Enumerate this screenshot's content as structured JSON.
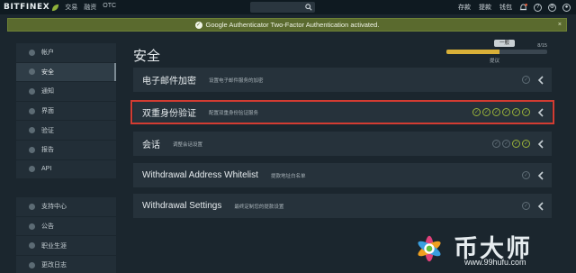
{
  "topbar": {
    "logo": "BITFINEX",
    "nav": [
      "交易",
      "融资",
      "OTC"
    ],
    "right_links": [
      "存款",
      "提款",
      "钱包"
    ],
    "icons": [
      "bell-icon",
      "help-icon",
      "settings-icon",
      "user-icon"
    ]
  },
  "notice": {
    "text": "Google Authenticator Two-Factor Authentication activated.",
    "close": "×"
  },
  "sidebar": {
    "group1": [
      {
        "label": "帐户",
        "icon": "account-icon"
      },
      {
        "label": "安全",
        "icon": "lock-icon",
        "active": true
      },
      {
        "label": "通知",
        "icon": "notification-icon"
      },
      {
        "label": "界面",
        "icon": "interface-icon"
      },
      {
        "label": "验证",
        "icon": "verify-icon"
      },
      {
        "label": "报告",
        "icon": "report-icon"
      },
      {
        "label": "API",
        "icon": "api-icon"
      }
    ],
    "group2": [
      {
        "label": "支持中心",
        "icon": "support-icon"
      },
      {
        "label": "公告",
        "icon": "announcement-icon"
      },
      {
        "label": "职业生涯",
        "icon": "career-icon"
      },
      {
        "label": "更改日志",
        "icon": "changelog-icon"
      }
    ]
  },
  "main": {
    "title": "安全",
    "security_level": {
      "badge": "一般",
      "fraction": "8/15",
      "progress": 0.53,
      "caption": "提议"
    },
    "rows": [
      {
        "title": "电子邮件加密",
        "desc": "设置电子邮件服务的加密",
        "checks": [
          "off"
        ]
      },
      {
        "title": "双重身份验证",
        "desc": "配置双重身份验证服务",
        "checks": [
          "on",
          "on",
          "on",
          "on",
          "on",
          "on"
        ],
        "highlighted": true
      },
      {
        "title": "会话",
        "desc": "调整会话设置",
        "checks": [
          "off",
          "off",
          "on",
          "on"
        ]
      },
      {
        "title": "Withdrawal Address Whitelist",
        "desc": "提款地址白名单",
        "checks": [
          "off"
        ]
      },
      {
        "title": "Withdrawal Settings",
        "desc": "最终定制您的提款设置",
        "checks": [
          "off"
        ]
      }
    ]
  },
  "watermark": {
    "text": "币大师",
    "url": "www.99hufu.com"
  },
  "colors": {
    "background": "#1b262e",
    "panel": "#26323b",
    "check_on": "#9ab43a",
    "check_off": "#5f6d76",
    "progress_fill": "#d9b038",
    "highlight": "#d33c32",
    "notice": "#5a6a2e"
  }
}
